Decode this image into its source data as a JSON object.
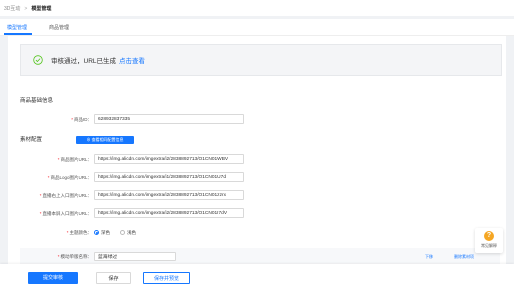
{
  "breadcrumb": {
    "root": "3D互动",
    "separator": ">",
    "current": "模型管理"
  },
  "tabs": [
    {
      "label": "模型管理",
      "active": true
    },
    {
      "label": "商品管理",
      "active": false
    }
  ],
  "notice": {
    "text": "审核通过，URL已生成",
    "link": "点击查看",
    "status_color": "#52c41a"
  },
  "sections": {
    "basic": "商品基础信息",
    "material": "素材配置"
  },
  "product_id": {
    "label": "商品ID：",
    "value": "628932837335"
  },
  "config_button": "查看相同配置信息",
  "fields": [
    {
      "label": "商品图片URL：",
      "value": "https://img.alicdn.com/imgextra/i2/2838892713/O1CN01WBV"
    },
    {
      "label": "商品Logo图片URL：",
      "value": "https://img.alicdn.com/imgextra/i1/2838892713/O1CN01U7d"
    },
    {
      "label": "直播右上入口图片URL：",
      "value": "https://img.alicdn.com/imgextra/i2/2838892713/O1CN01zzrx"
    },
    {
      "label": "直播本屏入口图片URL：",
      "value": "https://img.alicdn.com/imgextra/i2/2838892713/O1CN01I7dV"
    }
  ],
  "theme": {
    "label": "主题颜色：",
    "options": [
      "深色",
      "浅色"
    ],
    "selected": "深色"
  },
  "subpanel": {
    "label": "模动单版名称：",
    "value": "蓝海绿过",
    "link1": "下移",
    "link2": "删除素材项"
  },
  "footer": {
    "submit": "提交审核",
    "save": "保存",
    "save_preview": "保存并预览"
  },
  "help": {
    "icon": "?",
    "label": "常见解释"
  },
  "colors": {
    "accent": "#1677ff",
    "success": "#52c41a",
    "help": "#f5a623"
  }
}
